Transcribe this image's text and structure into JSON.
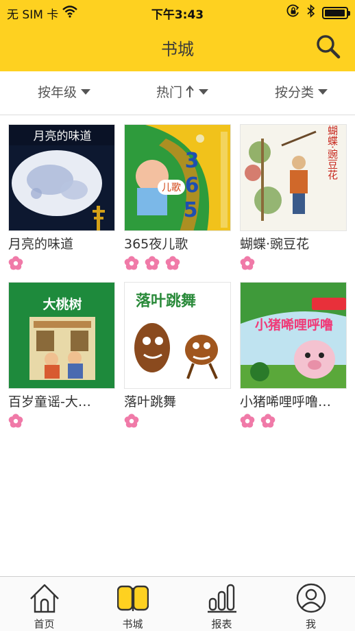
{
  "status_bar": {
    "carrier": "无 SIM 卡",
    "time": "下午3:43",
    "wifi_icon": "wifi-icon",
    "lock_icon": "orientation-lock-icon",
    "bluetooth_icon": "bluetooth-icon",
    "battery_icon": "battery-icon",
    "battery_level": 0.95
  },
  "header": {
    "title": "书城",
    "search_icon": "search-icon",
    "background_color": "#fed120"
  },
  "filters": {
    "grade": "按年级",
    "hot": "热门",
    "category": "按分类"
  },
  "books": [
    {
      "title": "月亮的味道",
      "cover_text": "月亮的味道",
      "rating": 1
    },
    {
      "title": "365夜儿歌",
      "cover_text": "儿歌",
      "rating": 3
    },
    {
      "title": "蝴蝶·豌豆花",
      "cover_text": "蝴蝶·豌豆花",
      "rating": 1
    },
    {
      "title": "百岁童谣-大…",
      "cover_text": "大桃树",
      "rating": 1
    },
    {
      "title": "落叶跳舞",
      "cover_text": "落叶跳舞",
      "rating": 1
    },
    {
      "title": "小猪唏哩呼噜…",
      "cover_text": "小猪唏哩呼噜",
      "rating": 2
    }
  ],
  "rating_icon": "flower-icon",
  "rating_color": "#f07aa8",
  "tabs": [
    {
      "label": "首页",
      "icon": "home-icon",
      "active": false
    },
    {
      "label": "书城",
      "icon": "open-book-icon",
      "active": true
    },
    {
      "label": "报表",
      "icon": "bar-chart-icon",
      "active": false
    },
    {
      "label": "我",
      "icon": "user-icon",
      "active": false
    }
  ]
}
